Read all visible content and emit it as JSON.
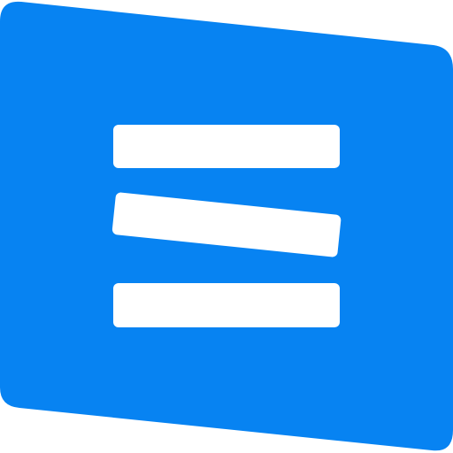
{
  "logo": {
    "icon": "menu-lines-logo-icon",
    "colors": {
      "background": "#0783F2",
      "bars": "#FFFFFF",
      "page": "#FFFFFF"
    }
  }
}
